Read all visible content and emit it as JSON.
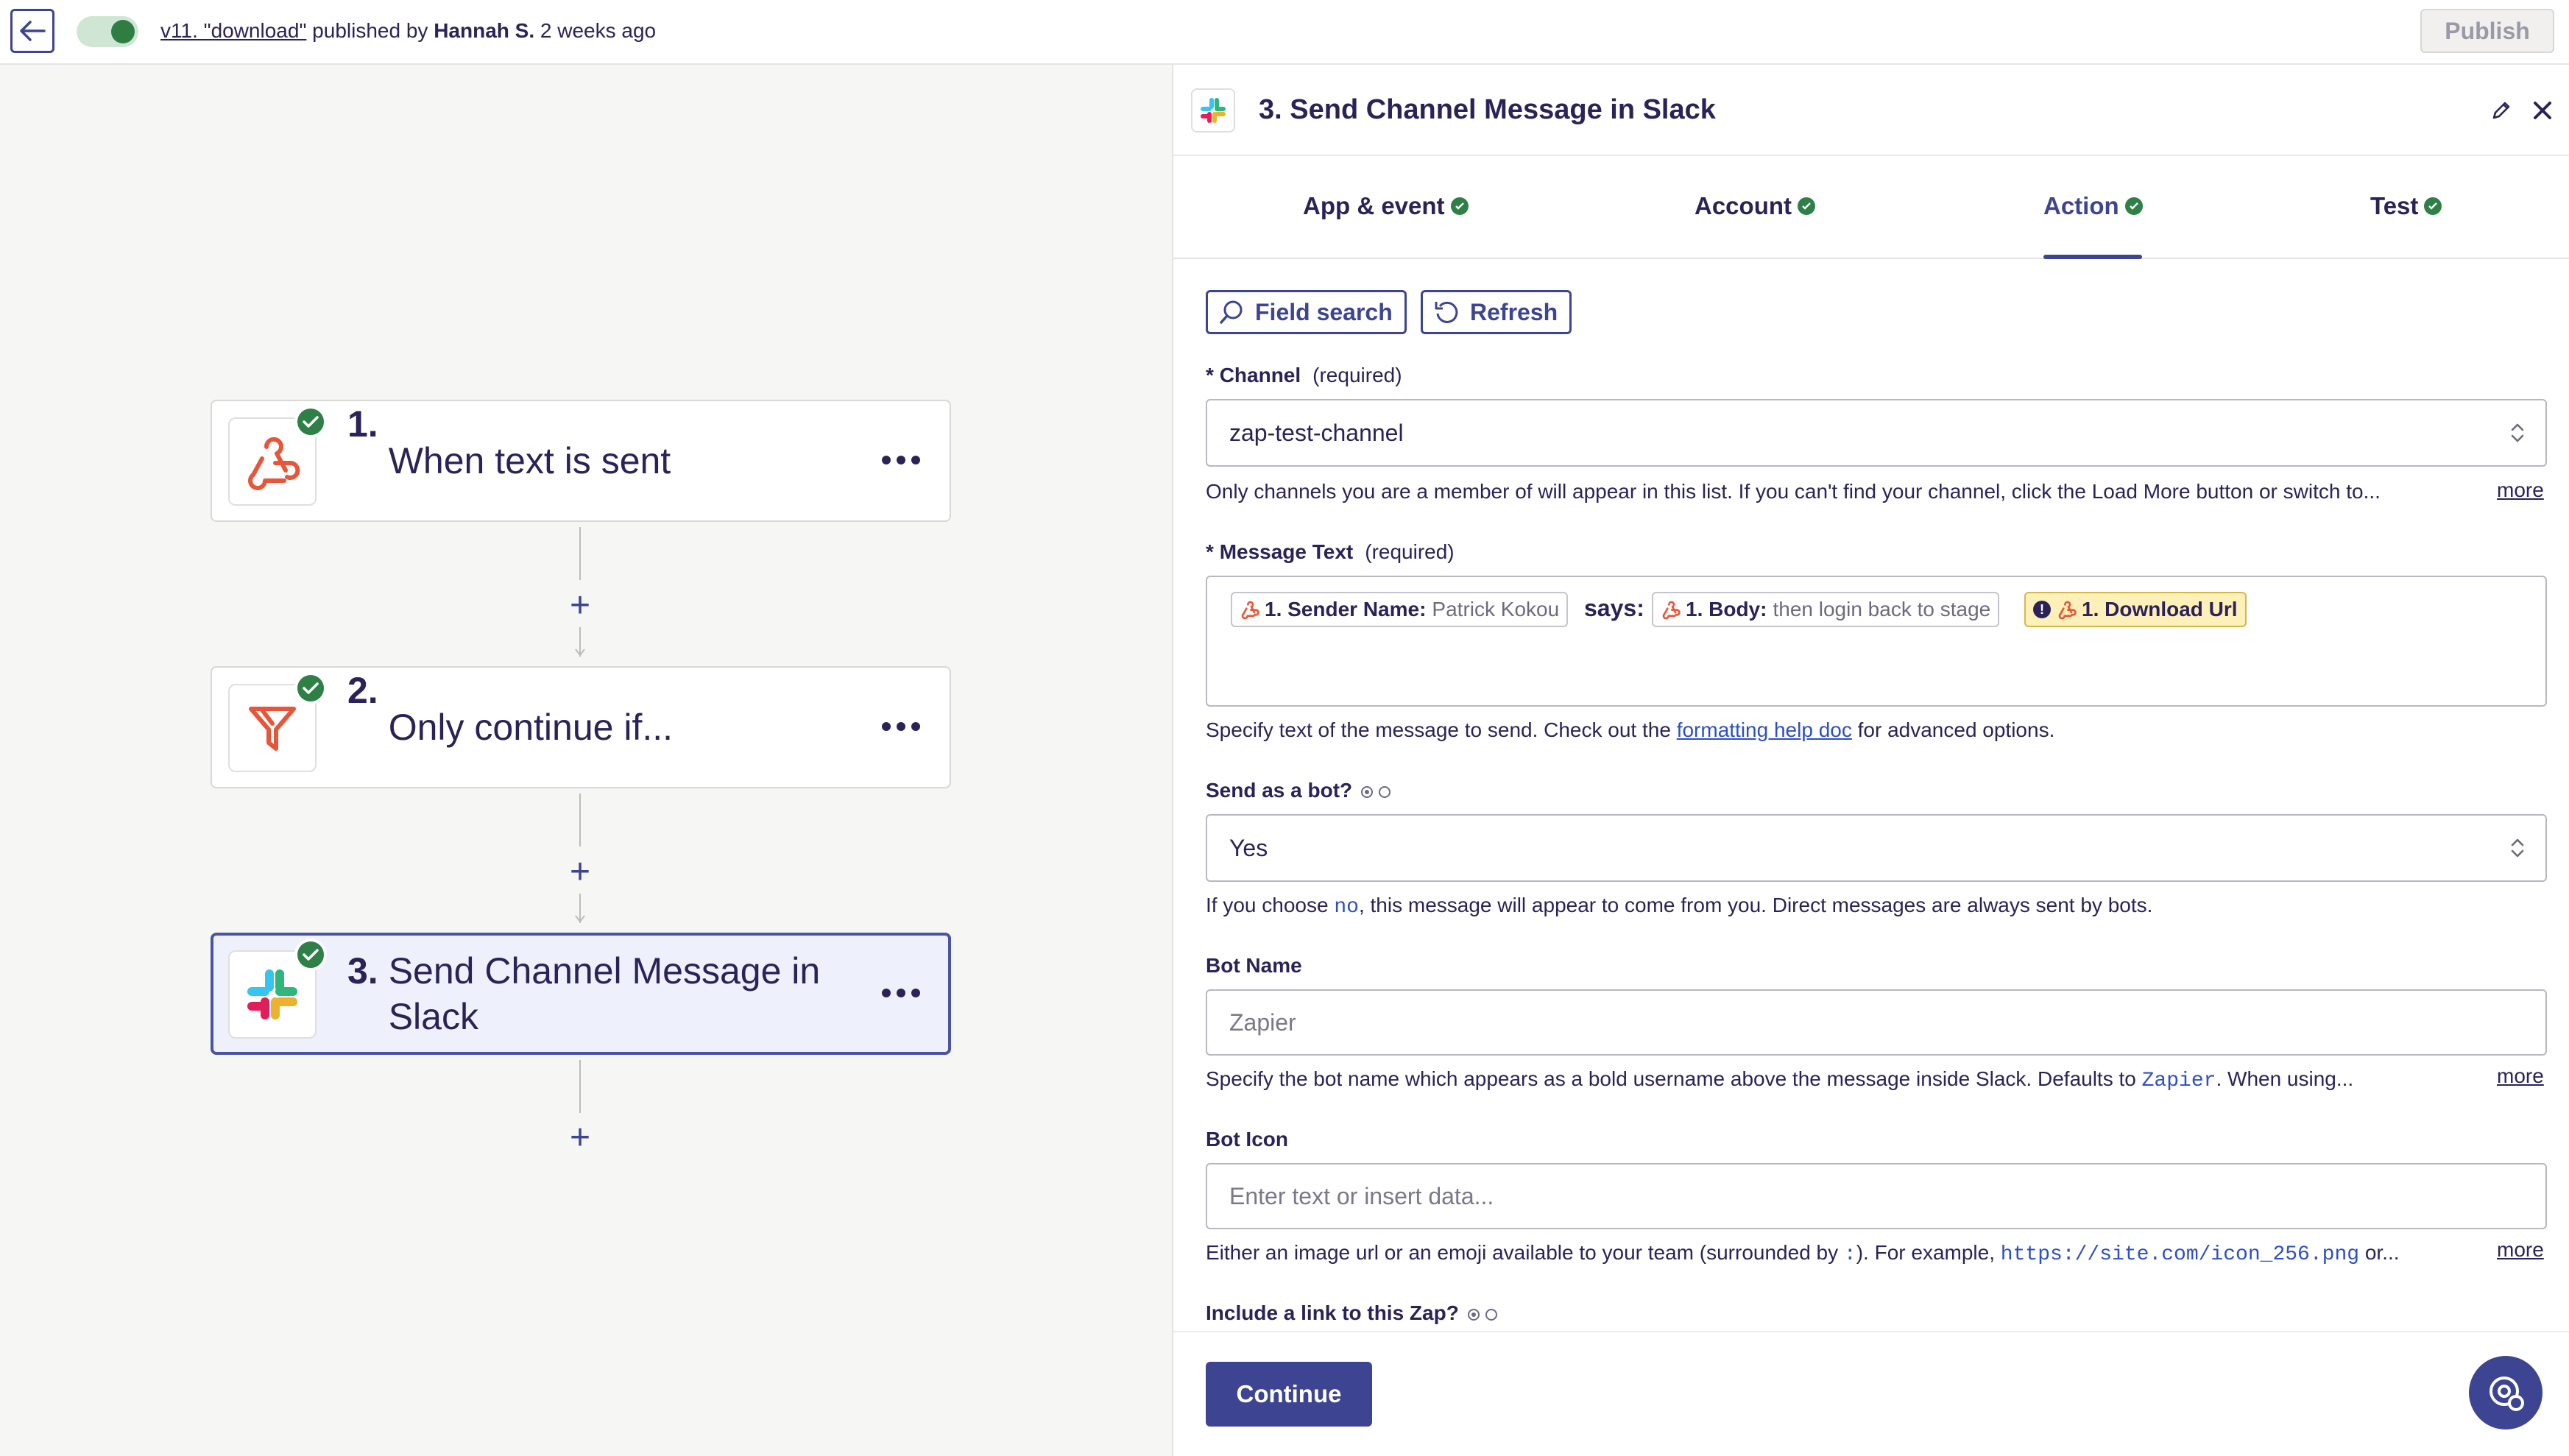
{
  "topbar": {
    "version_link": "v11. \"download\"",
    "published_by": " published by ",
    "author": "Hannah S.",
    "time_ago": " 2 weeks ago",
    "publish_label": "Publish"
  },
  "steps": [
    {
      "num": "1.",
      "title": "When text is sent",
      "app_icon": "webhook-icon"
    },
    {
      "num": "2.",
      "title": "Only continue if...",
      "app_icon": "filter-icon"
    },
    {
      "num": "3.",
      "title": "Send Channel Message in Slack",
      "app_icon": "slack-icon"
    }
  ],
  "panel": {
    "title": "3. Send Channel Message in Slack",
    "tabs": [
      {
        "label": "App & event"
      },
      {
        "label": "Account"
      },
      {
        "label": "Action"
      },
      {
        "label": "Test"
      }
    ],
    "field_search_label": "Field search",
    "refresh_label": "Refresh",
    "more_label": "more",
    "channel": {
      "label": "Channel",
      "required": "(required)",
      "value": "zap-test-channel",
      "help": "Only channels you are a member of will appear in this list. If you can't find your channel, click the Load More button or switch to..."
    },
    "message": {
      "label": "Message Text",
      "required": "(required)",
      "pill1_key": "1. Sender Name:",
      "pill1_val": "Patrick Kokou",
      "says": "says:",
      "pill2_key": "1. Body:",
      "pill2_val": "then login back to stage",
      "pill3_key": "1. Download Url",
      "help_pre": "Specify text of the message to send. Check out the ",
      "help_link": "formatting help doc",
      "help_post": " for advanced options."
    },
    "bot": {
      "label": "Send as a bot?",
      "value": "Yes",
      "help_pre": "If you choose ",
      "help_code": "no",
      "help_post": ", this message will appear to come from you. Direct messages are always sent by bots."
    },
    "bot_name": {
      "label": "Bot Name",
      "placeholder": "Zapier",
      "help_pre": "Specify the bot name which appears as a bold username above the message inside Slack. Defaults to ",
      "help_code": "Zapier",
      "help_post": ". When using..."
    },
    "bot_icon": {
      "label": "Bot Icon",
      "placeholder": "Enter text or insert data...",
      "help_pre": "Either an image url or an emoji available to your team (surrounded by ",
      "help_code1": ":",
      "help_mid": "). For example, ",
      "help_code2": "https://site.com/icon_256.png",
      "help_post": " or..."
    },
    "include_link": {
      "label": "Include a link to this Zap?"
    },
    "continue_label": "Continue"
  },
  "colors": {
    "brand": "#3d4592",
    "success": "#2f8046",
    "webhook": "#e8563a",
    "warning_pill": "#fdf0b8"
  }
}
